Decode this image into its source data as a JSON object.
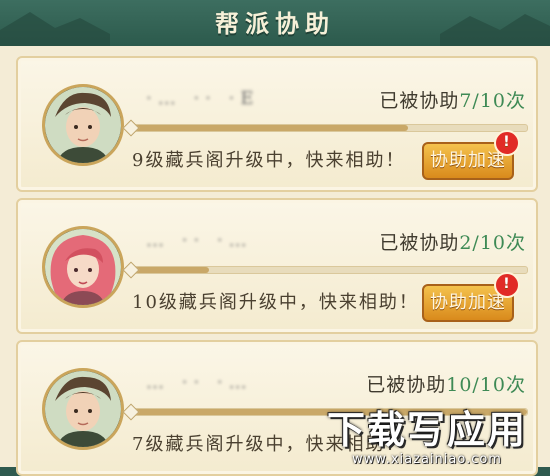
{
  "header": {
    "title": "帮派协助"
  },
  "cards": [
    {
      "name": "·… ·· ·E",
      "assist_label": "已被协助",
      "count": "7/10次",
      "progress": 0.7,
      "message": "9级藏兵阁升级中，快来相助！",
      "button": "协助加速",
      "alert": "!"
    },
    {
      "name": "… ·· ·…",
      "assist_label": "已被协助",
      "count": "2/10次",
      "progress": 0.2,
      "message": "10级藏兵阁升级中，快来相助！",
      "button": "协助加速",
      "alert": "!"
    },
    {
      "name": "… ·· ·…",
      "assist_label": "已被协助",
      "count": "10/10次",
      "progress": 1.0,
      "message": "7级藏兵阁升级中，快来相助！",
      "button": "",
      "alert": ""
    }
  ],
  "watermark": {
    "main": "下载写应用",
    "sub": "www.xiazainiao.com"
  },
  "colors": {
    "count": "#3e8a55",
    "button": "#e3a12e",
    "alert": "#e12b26"
  }
}
